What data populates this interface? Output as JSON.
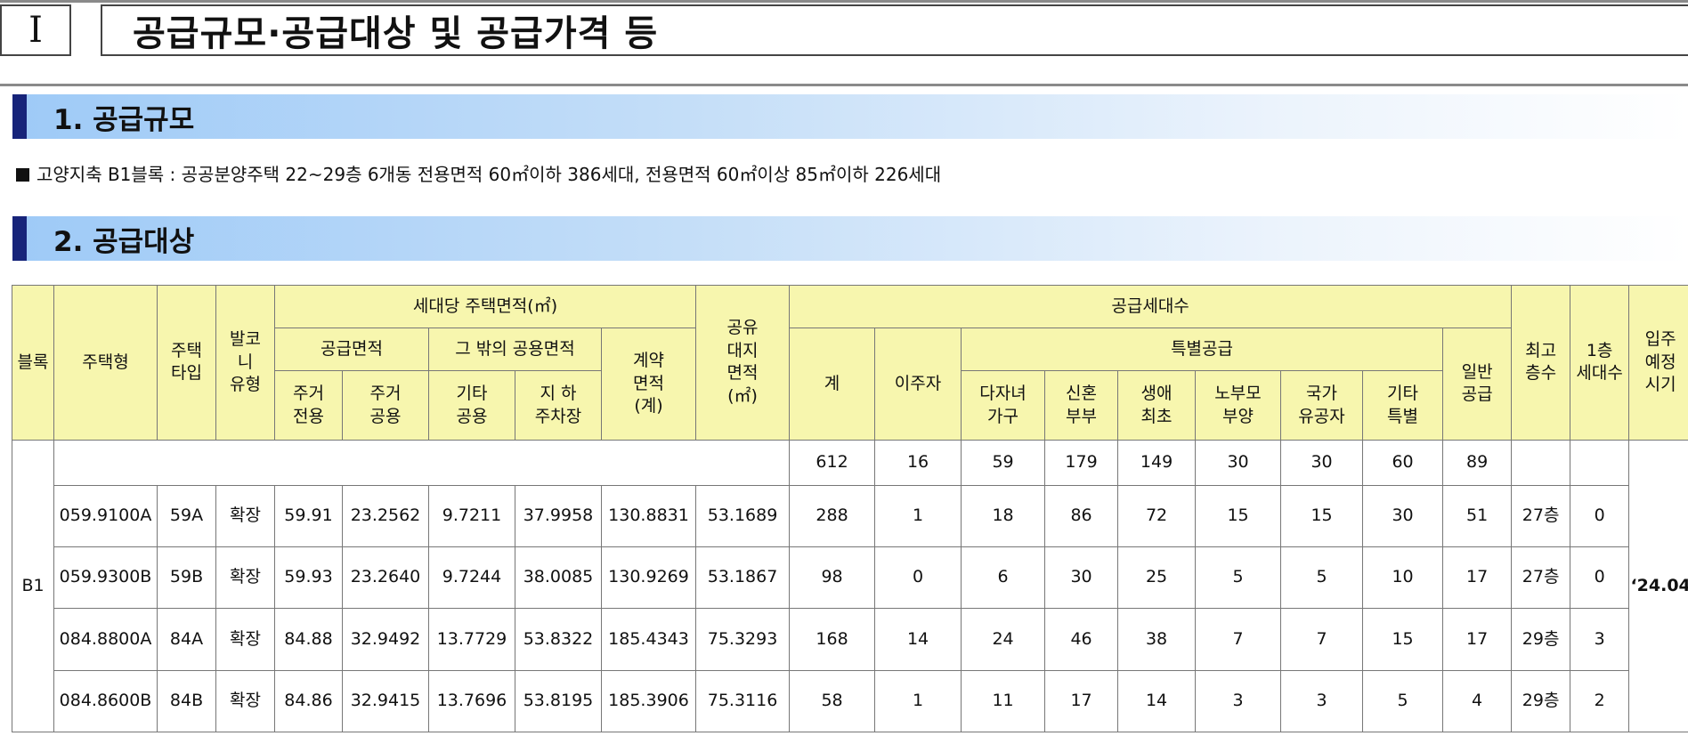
{
  "header": {
    "roman": "I",
    "title": "공급규모·공급대상 및 공급가격 등"
  },
  "sections": [
    {
      "label": "1. 공급규모"
    },
    {
      "label": "2. 공급대상"
    }
  ],
  "summary": "고양지축 B1블록 : 공공분양주택 22~29층 6개동 전용면적 60㎡이하 386세대, 전용면적 60㎡이상 85㎡이하 226세대",
  "table": {
    "headers": {
      "block": "블록",
      "housing_type": "주택형",
      "type": "주택\n타입",
      "balcony": "발코\n니\n유형",
      "area_group": "세대당 주택면적(㎡)",
      "supply_area": "공급면적",
      "other_common": "그 밖의 공용면적",
      "contract_area": "계약\n면적\n(계)",
      "land_area": "공유\n대지\n면적\n(㎡)",
      "households_group": "공급세대수",
      "total": "계",
      "relocatee": "이주자",
      "special_group": "특별공급",
      "general": "일반\n공급",
      "max_floor": "최고\n층수",
      "first_floor": "1층\n세대수",
      "move_in": "입주\n예정\n시기",
      "exclusive": "주거\n전용",
      "common": "주거\n공용",
      "other": "기타\n공용",
      "parking": "지  하\n주차장",
      "multi_child": "다자녀\n가구",
      "newlywed": "신혼\n부부",
      "first_time": "생애\n최초",
      "elderly": "노부모\n부양",
      "merit": "국가\n유공자",
      "other_special": "기타\n특별"
    },
    "block_name": "B1",
    "move_in_date": "‘24.04",
    "totals": {
      "total": "612",
      "relocatee": "16",
      "multi_child": "59",
      "newlywed": "179",
      "first_time": "149",
      "elderly": "30",
      "merit": "30",
      "other_special": "60",
      "general": "89"
    },
    "rows": [
      {
        "housing_type": "059.9100A",
        "type": "59A",
        "balcony": "확장",
        "exclusive": "59.91",
        "common": "23.2562",
        "other": "9.7211",
        "parking": "37.9958",
        "contract": "130.8831",
        "land": "53.1689",
        "total": "288",
        "relocatee": "1",
        "multi_child": "18",
        "newlywed": "86",
        "first_time": "72",
        "elderly": "15",
        "merit": "15",
        "other_special": "30",
        "general": "51",
        "max_floor": "27층",
        "first_floor": "0"
      },
      {
        "housing_type": "059.9300B",
        "type": "59B",
        "balcony": "확장",
        "exclusive": "59.93",
        "common": "23.2640",
        "other": "9.7244",
        "parking": "38.0085",
        "contract": "130.9269",
        "land": "53.1867",
        "total": "98",
        "relocatee": "0",
        "multi_child": "6",
        "newlywed": "30",
        "first_time": "25",
        "elderly": "5",
        "merit": "5",
        "other_special": "10",
        "general": "17",
        "max_floor": "27층",
        "first_floor": "0"
      },
      {
        "housing_type": "084.8800A",
        "type": "84A",
        "balcony": "확장",
        "exclusive": "84.88",
        "common": "32.9492",
        "other": "13.7729",
        "parking": "53.8322",
        "contract": "185.4343",
        "land": "75.3293",
        "total": "168",
        "relocatee": "14",
        "multi_child": "24",
        "newlywed": "46",
        "first_time": "38",
        "elderly": "7",
        "merit": "7",
        "other_special": "15",
        "general": "17",
        "max_floor": "29층",
        "first_floor": "3"
      },
      {
        "housing_type": "084.8600B",
        "type": "84B",
        "balcony": "확장",
        "exclusive": "84.86",
        "common": "32.9415",
        "other": "13.7696",
        "parking": "53.8195",
        "contract": "185.3906",
        "land": "75.3116",
        "total": "58",
        "relocatee": "1",
        "multi_child": "11",
        "newlywed": "17",
        "first_time": "14",
        "elderly": "3",
        "merit": "3",
        "other_special": "5",
        "general": "4",
        "max_floor": "29층",
        "first_floor": "2"
      }
    ]
  }
}
